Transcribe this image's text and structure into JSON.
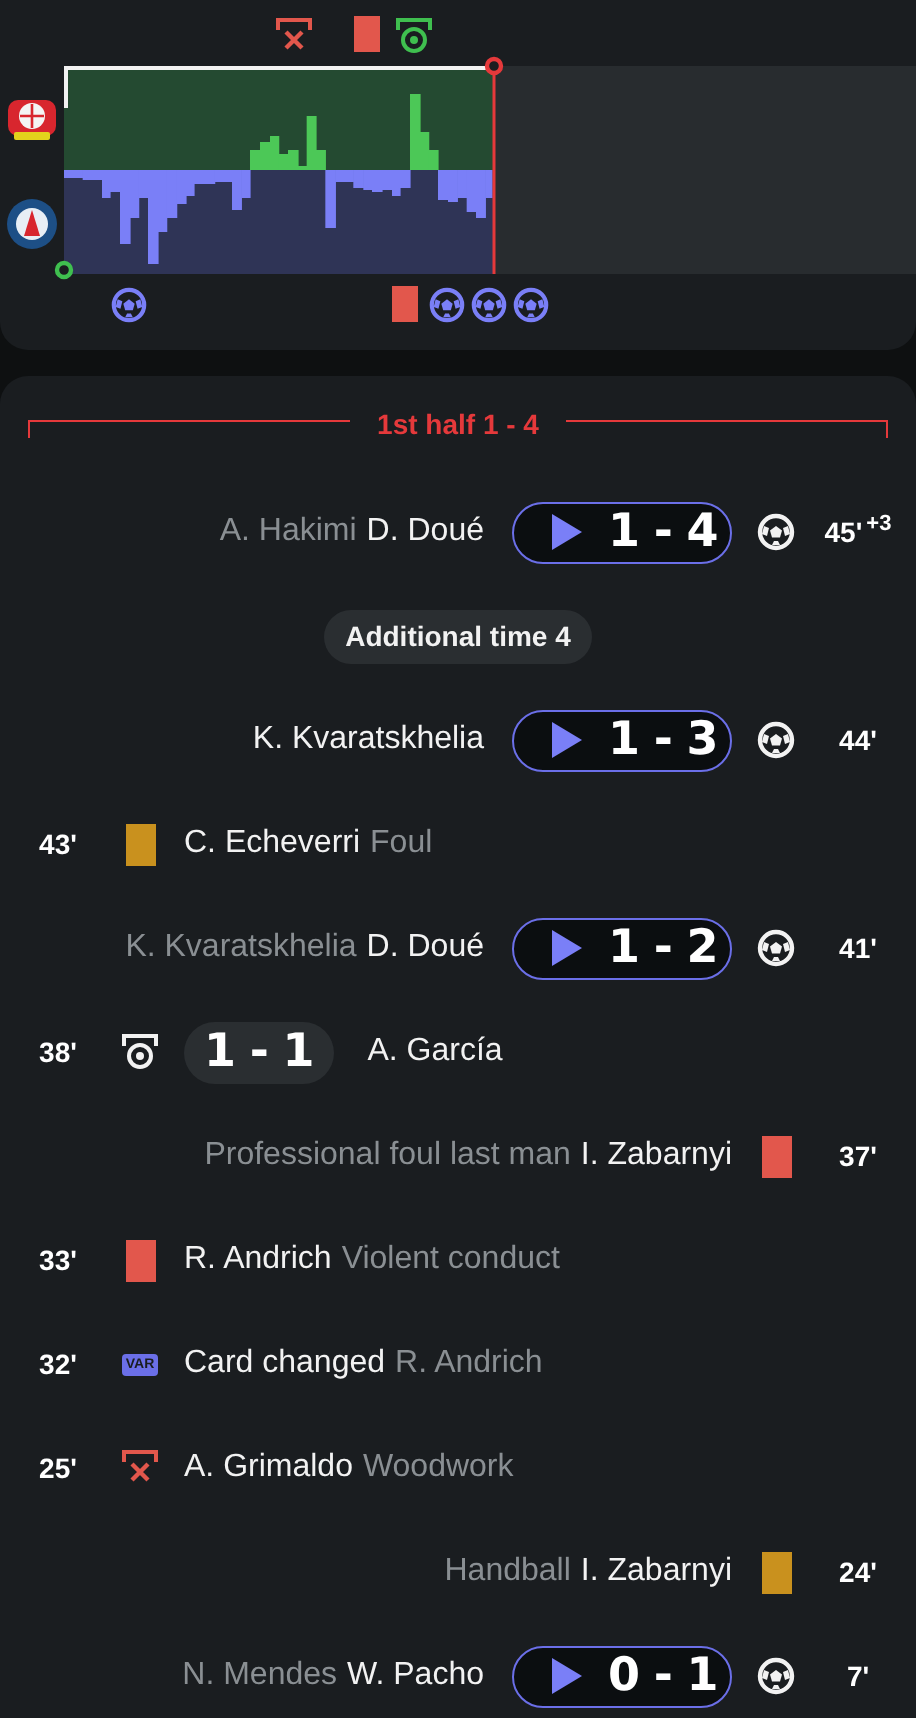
{
  "period": {
    "label": "1st half 1 - 4"
  },
  "events": [
    {
      "kind": "away_goal",
      "secondary": "A. Hakimi",
      "primary": "D. Doué",
      "score": "1 - 4",
      "minute": "45'",
      "extra": "+3"
    },
    {
      "kind": "notice",
      "text": "Additional time 4"
    },
    {
      "kind": "away_goal",
      "primary": "K. Kvaratskhelia",
      "score": "1 - 3",
      "minute": "44'"
    },
    {
      "kind": "home_yellow_card",
      "primary": "C. Echeverri",
      "secondary": "Foul",
      "minute": "43'"
    },
    {
      "kind": "away_goal",
      "secondary": "K. Kvaratskhelia",
      "primary": "D. Doué",
      "score": "1 - 2",
      "minute": "41'"
    },
    {
      "kind": "home_goal",
      "primary": "A. García",
      "score": "1 - 1",
      "minute": "38'"
    },
    {
      "kind": "away_red_card",
      "secondary": "Professional foul last man",
      "primary": "I. Zabarnyi",
      "minute": "37'"
    },
    {
      "kind": "home_red_card",
      "primary": "R. Andrich",
      "secondary": "Violent conduct",
      "minute": "33'"
    },
    {
      "kind": "home_var",
      "tag": "VAR",
      "primary": "Card changed",
      "secondary": "R. Andrich",
      "minute": "32'"
    },
    {
      "kind": "home_woodwork",
      "primary": "A. Grimaldo",
      "secondary": "Woodwork",
      "minute": "25'"
    },
    {
      "kind": "away_yellow_card",
      "secondary": "Handball",
      "primary": "I. Zabarnyi",
      "minute": "24'"
    },
    {
      "kind": "away_goal",
      "secondary": "N. Mendes",
      "primary": "W. Pacho",
      "score": "0 - 1",
      "minute": "7'"
    }
  ]
}
